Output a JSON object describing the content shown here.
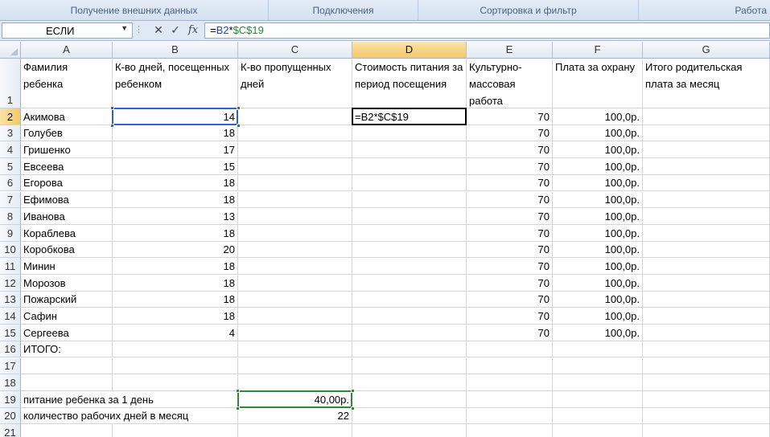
{
  "ribbon": {
    "groups": [
      {
        "label": "Получение внешних данных"
      },
      {
        "label": "Подключения"
      },
      {
        "label": "Сортировка и фильтр"
      },
      {
        "label": "Работа"
      }
    ]
  },
  "formula_bar": {
    "name_box": "ЕСЛИ",
    "cancel_icon": "cancel-x-icon",
    "enter_icon": "checkmark-icon",
    "fx_label": "fx",
    "formula_parts": [
      {
        "text": "=",
        "color": "#000000"
      },
      {
        "text": "B2",
        "color": "#1f3fd8"
      },
      {
        "text": "*",
        "color": "#000000"
      },
      {
        "text": "$C$19",
        "color": "#1e8a2f"
      }
    ]
  },
  "columns": [
    "A",
    "B",
    "C",
    "D",
    "E",
    "F",
    "G"
  ],
  "active_column": "D",
  "active_row": "2",
  "rows": [
    {
      "n": "1",
      "A": "Фамилия ребенка",
      "B": "К-во дней, посещенных ребенком",
      "C": "К-во пропущенных дней",
      "D": "Стоимость питания за период посещения",
      "E": "Культурно-массовая работа",
      "F": "Плата за охрану",
      "G": "Итого родительская плата за месяц"
    },
    {
      "n": "2",
      "A": "Акимова",
      "B": "14",
      "C": "",
      "D": "=B2*$C$19",
      "E": "70",
      "F": "100,0р.",
      "G": ""
    },
    {
      "n": "3",
      "A": "Голубев",
      "B": "18",
      "C": "",
      "D": "",
      "E": "70",
      "F": "100,0р.",
      "G": ""
    },
    {
      "n": "4",
      "A": "Гришенко",
      "B": "17",
      "C": "",
      "D": "",
      "E": "70",
      "F": "100,0р.",
      "G": ""
    },
    {
      "n": "5",
      "A": "Евсеева",
      "B": "15",
      "C": "",
      "D": "",
      "E": "70",
      "F": "100,0р.",
      "G": ""
    },
    {
      "n": "6",
      "A": "Егорова",
      "B": "18",
      "C": "",
      "D": "",
      "E": "70",
      "F": "100,0р.",
      "G": ""
    },
    {
      "n": "7",
      "A": "Ефимова",
      "B": "18",
      "C": "",
      "D": "",
      "E": "70",
      "F": "100,0р.",
      "G": ""
    },
    {
      "n": "8",
      "A": "Иванова",
      "B": "13",
      "C": "",
      "D": "",
      "E": "70",
      "F": "100,0р.",
      "G": ""
    },
    {
      "n": "9",
      "A": "Кораблева",
      "B": "18",
      "C": "",
      "D": "",
      "E": "70",
      "F": "100,0р.",
      "G": ""
    },
    {
      "n": "10",
      "A": "Коробкова",
      "B": "20",
      "C": "",
      "D": "",
      "E": "70",
      "F": "100,0р.",
      "G": ""
    },
    {
      "n": "11",
      "A": "Минин",
      "B": "18",
      "C": "",
      "D": "",
      "E": "70",
      "F": "100,0р.",
      "G": ""
    },
    {
      "n": "12",
      "A": "Морозов",
      "B": "18",
      "C": "",
      "D": "",
      "E": "70",
      "F": "100,0р.",
      "G": ""
    },
    {
      "n": "13",
      "A": "Пожарский",
      "B": "18",
      "C": "",
      "D": "",
      "E": "70",
      "F": "100,0р.",
      "G": ""
    },
    {
      "n": "14",
      "A": "Сафин",
      "B": "18",
      "C": "",
      "D": "",
      "E": "70",
      "F": "100,0р.",
      "G": ""
    },
    {
      "n": "15",
      "A": "Сергеева",
      "B": "4",
      "C": "",
      "D": "",
      "E": "70",
      "F": "100,0р.",
      "G": ""
    },
    {
      "n": "16",
      "A": "ИТОГО:",
      "B": "",
      "C": "",
      "D": "",
      "E": "",
      "F": "",
      "G": ""
    },
    {
      "n": "17",
      "A": "",
      "B": "",
      "C": "",
      "D": "",
      "E": "",
      "F": "",
      "G": ""
    },
    {
      "n": "18",
      "A": "",
      "B": "",
      "C": "",
      "D": "",
      "E": "",
      "F": "",
      "G": ""
    },
    {
      "n": "19",
      "A": "питание ребенка за 1 день",
      "B": "",
      "C": "40,00р.",
      "D": "",
      "E": "",
      "F": "",
      "G": ""
    },
    {
      "n": "20",
      "A": "количество рабочих дней в месяц",
      "B": "",
      "C": "22",
      "D": "",
      "E": "",
      "F": "",
      "G": ""
    },
    {
      "n": "21",
      "A": "",
      "B": "",
      "C": "",
      "D": "",
      "E": "",
      "F": "",
      "G": ""
    }
  ],
  "colors": {
    "selection": "#3260c8",
    "reference": "#2c8a37",
    "active_header": "#f5c767"
  }
}
